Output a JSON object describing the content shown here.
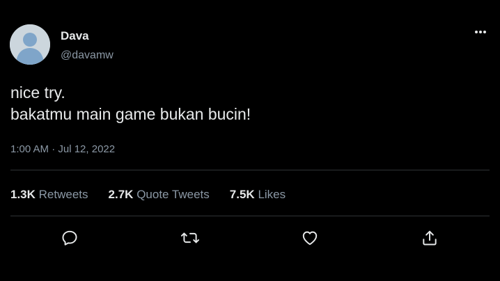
{
  "author": {
    "name": "Dava",
    "handle": "@davamw"
  },
  "tweet": {
    "lines": [
      "nice try.",
      "bakatmu main game bukan bucin!"
    ],
    "timestamp": "1:00 AM · Jul 12, 2022"
  },
  "stats": {
    "retweets": {
      "count": "1.3K",
      "label": "Retweets"
    },
    "quotes": {
      "count": "2.7K",
      "label": "Quote Tweets"
    },
    "likes": {
      "count": "7.5K",
      "label": "Likes"
    }
  },
  "actions": [
    "reply-icon",
    "retweet-icon",
    "like-icon",
    "share-icon"
  ],
  "colors": {
    "background": "#000000",
    "text": "#e7e9ea",
    "secondary": "#8b98a5",
    "divider": "#2f3336",
    "avatar_bg": "#ccd6dd",
    "avatar_fg": "#b8c4d0"
  }
}
